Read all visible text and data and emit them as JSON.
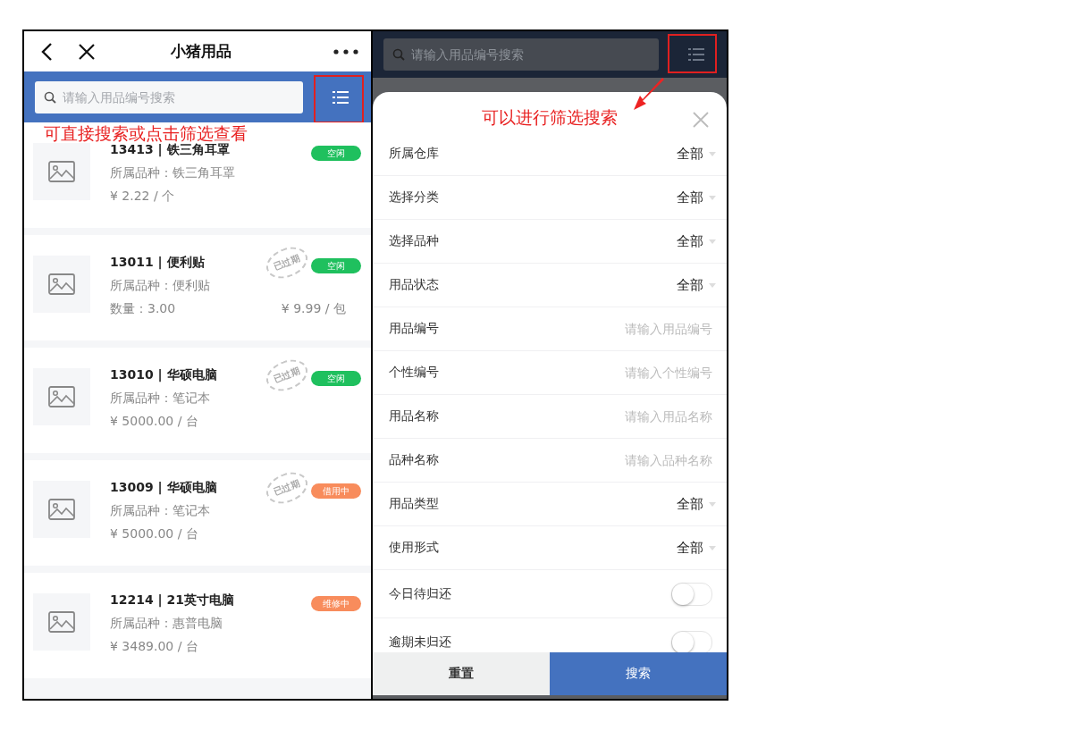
{
  "left_screen": {
    "nav": {
      "title": "小猪用品"
    },
    "search": {
      "placeholder": "请输入用品编号搜索"
    },
    "annotation": "可直接搜索或点击筛选查看",
    "items": [
      {
        "title": "13413 | 铁三角耳罩",
        "variety": "所属品种：铁三角耳罩",
        "price": "¥ 2.22 / 个",
        "status": "空闲",
        "color": "#1fc05e"
      },
      {
        "title": "13011 | 便利贴",
        "variety": "所属品种：便利贴",
        "quantity": "数量：3.00",
        "price": "¥ 9.99 / 包",
        "status": "空闲",
        "color": "#1fc05e",
        "stamp": "已过期"
      },
      {
        "title": "13010 | 华硕电脑",
        "variety": "所属品种：笔记本",
        "price": "¥ 5000.00 / 台",
        "status": "空闲",
        "color": "#1fc05e",
        "stamp": "已过期"
      },
      {
        "title": "13009 | 华硕电脑",
        "variety": "所属品种：笔记本",
        "price": "¥ 5000.00 / 台",
        "status": "借用中",
        "color": "#f88c5c",
        "stamp": "已过期"
      },
      {
        "title": "12214 | 21英寸电脑",
        "variety": "所属品种：惠普电脑",
        "price": "¥ 3489.00 / 台",
        "status": "维修中",
        "color": "#f88c5c"
      }
    ]
  },
  "right_screen": {
    "search": {
      "placeholder": "请输入用品编号搜索"
    },
    "filter_sheet": {
      "title": "可以进行筛选搜索",
      "fields": [
        {
          "kind": "select",
          "label": "所属仓库",
          "value": "全部"
        },
        {
          "kind": "select",
          "label": "选择分类",
          "value": "全部"
        },
        {
          "kind": "select",
          "label": "选择品种",
          "value": "全部"
        },
        {
          "kind": "select",
          "label": "用品状态",
          "value": "全部"
        },
        {
          "kind": "input",
          "label": "用品编号",
          "placeholder": "请输入用品编号"
        },
        {
          "kind": "input",
          "label": "个性编号",
          "placeholder": "请输入个性编号"
        },
        {
          "kind": "input",
          "label": "用品名称",
          "placeholder": "请输入用品名称"
        },
        {
          "kind": "input",
          "label": "品种名称",
          "placeholder": "请输入品种名称"
        },
        {
          "kind": "select",
          "label": "用品类型",
          "value": "全部"
        },
        {
          "kind": "select",
          "label": "使用形式",
          "value": "全部"
        },
        {
          "kind": "toggle",
          "label": "今日待归还",
          "on": false
        },
        {
          "kind": "toggle",
          "label": "逾期未归还",
          "on": false
        }
      ],
      "buttons": [
        {
          "kind": "secondary",
          "label": "重置"
        },
        {
          "kind": "primary",
          "label": "搜索"
        }
      ]
    }
  }
}
